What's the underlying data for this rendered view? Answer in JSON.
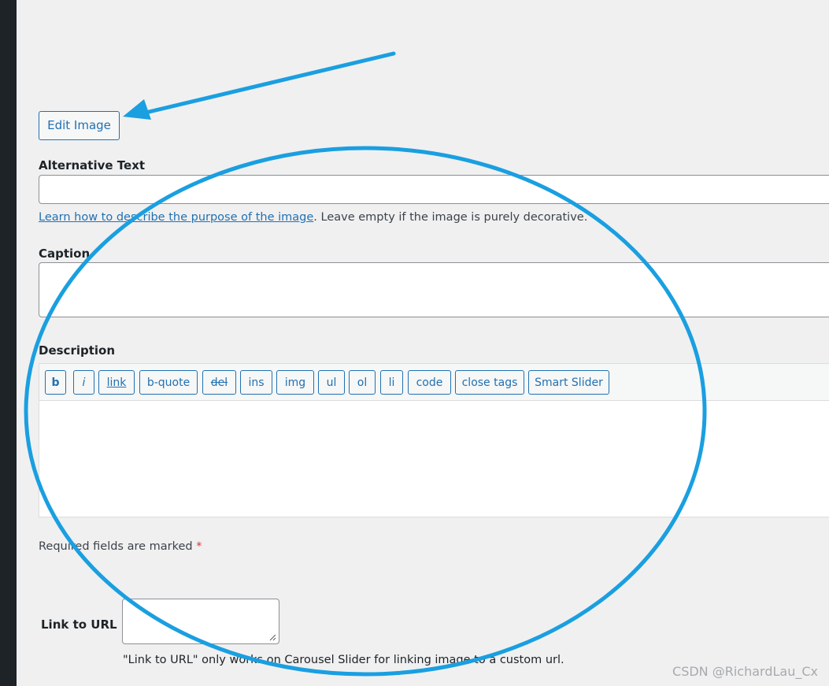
{
  "edit_image_label": "Edit Image",
  "alt_text": {
    "label": "Alternative Text",
    "value": "",
    "help_link": "Learn how to describe the purpose of the image",
    "help_suffix": ". Leave empty if the image is purely decorative."
  },
  "caption": {
    "label": "Caption",
    "value": ""
  },
  "description": {
    "label": "Description",
    "value": "",
    "toolbar": [
      "b",
      "i",
      "link",
      "b-quote",
      "del",
      "ins",
      "img",
      "ul",
      "ol",
      "li",
      "code",
      "close tags",
      "Smart Slider"
    ]
  },
  "required_note": {
    "text": "Required fields are marked ",
    "star": "*"
  },
  "link_to_url": {
    "label": "Link to URL",
    "value": "",
    "note": "\"Link to URL\" only works on Carousel Slider for linking image to a custom url."
  },
  "watermark": "CSDN @RichardLau_Cx",
  "annotation_color": "#1a9fe0"
}
